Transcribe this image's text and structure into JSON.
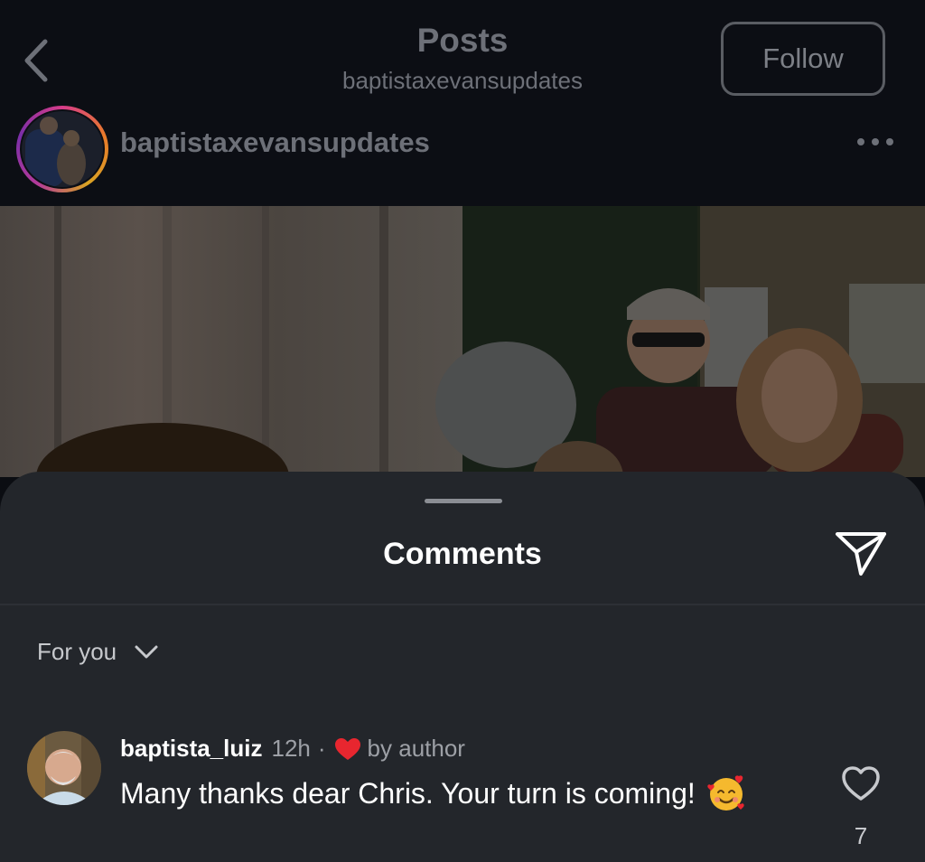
{
  "header": {
    "title": "Posts",
    "subtitle": "baptistaxevansupdates",
    "follow_label": "Follow"
  },
  "post": {
    "username": "baptistaxevansupdates"
  },
  "comments_sheet": {
    "title": "Comments",
    "sort_label": "For you",
    "comments": [
      {
        "username": "baptista_luiz",
        "time": "12h",
        "separator": "·",
        "author_like": "by author",
        "text": "Many thanks dear Chris. Your turn is coming!",
        "likes": "7"
      }
    ]
  },
  "icons": {
    "back": "chevron-left-icon",
    "more": "more-horizontal-icon",
    "share": "send-icon",
    "sort": "chevron-down-icon",
    "author_heart": "heart-filled-icon",
    "emoji": "smiling-face-with-hearts-emoji",
    "like": "heart-outline-icon"
  },
  "colors": {
    "background": "#0b0d12",
    "sheet": "#23262b",
    "heart": "#e8262f"
  }
}
